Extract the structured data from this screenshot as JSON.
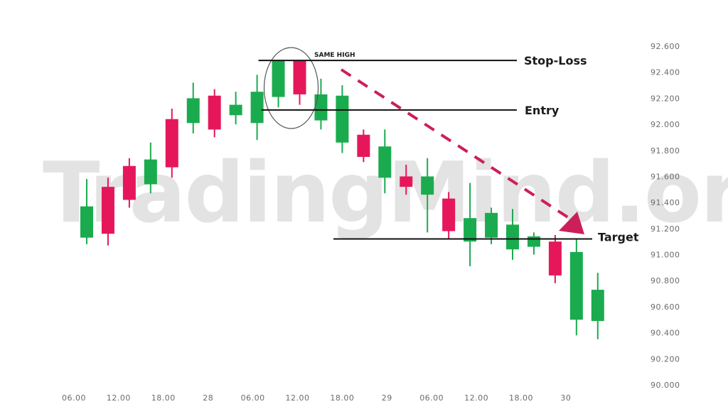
{
  "chart_data": {
    "type": "candlestick",
    "title": "",
    "xlabel": "",
    "ylabel": "",
    "ylim": [
      90.0,
      92.6
    ],
    "grid": false,
    "watermark": "TradingMind.org",
    "colors": {
      "up": "#1bab4f",
      "down": "#e5175a",
      "annotation_line": "#111111",
      "trend_arrow": "#cc1f5a",
      "ellipse": "#555555",
      "watermark": "#e3e3e3",
      "tick_text": "#6b6b6b"
    },
    "y_ticks": [
      "92.600",
      "92.400",
      "92.200",
      "92.000",
      "91.800",
      "91.600",
      "91.400",
      "91.200",
      "91.000",
      "90.800",
      "90.600",
      "90.400",
      "90.200",
      "90.000"
    ],
    "y_tick_values": [
      92.6,
      92.4,
      92.2,
      92.0,
      91.8,
      91.6,
      91.4,
      91.2,
      91.0,
      90.8,
      90.6,
      90.4,
      90.2,
      90.0
    ],
    "x_ticks": [
      {
        "label": "06.00",
        "index": -0.6
      },
      {
        "label": "12.00",
        "index": 1.5
      },
      {
        "label": "18.00",
        "index": 3.6
      },
      {
        "label": "28",
        "index": 5.7
      },
      {
        "label": "06.00",
        "index": 7.8
      },
      {
        "label": "12.00",
        "index": 9.9
      },
      {
        "label": "18.00",
        "index": 12.0
      },
      {
        "label": "29",
        "index": 14.1
      },
      {
        "label": "06.00",
        "index": 16.2
      },
      {
        "label": "12.00",
        "index": 18.3
      },
      {
        "label": "18.00",
        "index": 20.4
      },
      {
        "label": "30",
        "index": 22.5
      }
    ],
    "candles": [
      {
        "open": 91.13,
        "high": 91.58,
        "low": 91.08,
        "close": 91.37
      },
      {
        "open": 91.52,
        "high": 91.59,
        "low": 91.07,
        "close": 91.16
      },
      {
        "open": 91.68,
        "high": 91.74,
        "low": 91.36,
        "close": 91.42
      },
      {
        "open": 91.54,
        "high": 91.86,
        "low": 91.47,
        "close": 91.73
      },
      {
        "open": 92.04,
        "high": 92.12,
        "low": 91.59,
        "close": 91.67
      },
      {
        "open": 92.01,
        "high": 92.32,
        "low": 91.93,
        "close": 92.2
      },
      {
        "open": 92.22,
        "high": 92.27,
        "low": 91.9,
        "close": 91.96
      },
      {
        "open": 92.07,
        "high": 92.25,
        "low": 92.0,
        "close": 92.15
      },
      {
        "open": 92.01,
        "high": 92.38,
        "low": 91.88,
        "close": 92.25
      },
      {
        "open": 92.21,
        "high": 92.49,
        "low": 92.13,
        "close": 92.49
      },
      {
        "open": 92.49,
        "high": 92.49,
        "low": 92.15,
        "close": 92.23
      },
      {
        "open": 92.03,
        "high": 92.35,
        "low": 91.96,
        "close": 92.23
      },
      {
        "open": 91.86,
        "high": 92.3,
        "low": 91.78,
        "close": 92.22
      },
      {
        "open": 91.92,
        "high": 91.96,
        "low": 91.71,
        "close": 91.75
      },
      {
        "open": 91.59,
        "high": 91.96,
        "low": 91.47,
        "close": 91.83
      },
      {
        "open": 91.6,
        "high": 91.69,
        "low": 91.46,
        "close": 91.52
      },
      {
        "open": 91.46,
        "high": 91.74,
        "low": 91.17,
        "close": 91.6
      },
      {
        "open": 91.43,
        "high": 91.48,
        "low": 91.12,
        "close": 91.18
      },
      {
        "open": 91.1,
        "high": 91.55,
        "low": 90.91,
        "close": 91.28
      },
      {
        "open": 91.13,
        "high": 91.36,
        "low": 91.08,
        "close": 91.32
      },
      {
        "open": 91.04,
        "high": 91.35,
        "low": 90.96,
        "close": 91.23
      },
      {
        "open": 91.06,
        "high": 91.17,
        "low": 91.0,
        "close": 91.14
      },
      {
        "open": 91.1,
        "high": 91.15,
        "low": 90.78,
        "close": 90.84
      },
      {
        "open": 90.5,
        "high": 91.12,
        "low": 90.38,
        "close": 91.02
      },
      {
        "open": 90.49,
        "high": 90.86,
        "low": 90.35,
        "close": 90.73
      }
    ],
    "annotations": {
      "same_high_label": "SAME HIGH",
      "stop_loss": {
        "label": "Stop-Loss",
        "price": 92.49,
        "from_index": 9.0
      },
      "entry": {
        "label": "Entry",
        "price": 92.11,
        "from_index": 9.0
      },
      "target": {
        "label": "Target",
        "price": 91.12,
        "from_index": 12.3
      },
      "highlight_candles": [
        9,
        10
      ],
      "trend_arrow": {
        "from": {
          "index": 12.0,
          "price": 92.45
        },
        "to": {
          "index": 23.2,
          "price": 91.14
        }
      }
    }
  }
}
